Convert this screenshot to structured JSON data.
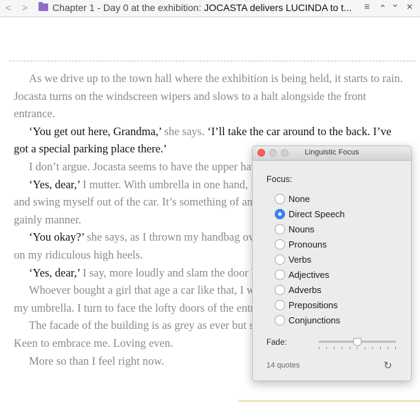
{
  "header": {
    "back_glyph": "<",
    "forward_glyph": ">",
    "title_prefix": "Chapter 1 - Day 0 at the exhibition: ",
    "title_bold": "JOCASTA delivers LUCINDA to t...",
    "menu_glyph": "≡",
    "up_glyph": "⌃",
    "down_glyph": "⌄",
    "close_glyph": "✕"
  },
  "editor": {
    "paragraphs": [
      [
        {
          "t": "As we drive up to the town hall where the exhibition is being held, it starts to rain. Jocasta turns on the windscreen wipers and slows to a halt alongside the front entrance.",
          "s": false
        }
      ],
      [
        {
          "t": "‘You get out here, Grandma,’",
          "s": true
        },
        {
          "t": " she says. ",
          "s": false
        },
        {
          "t": "‘I’ll take the car around to the back. I’ve got a special parking place there.’",
          "s": true
        }
      ],
      [
        {
          "t": "I don’t argue. Jocasta seems to have the upper hand today.",
          "s": false
        }
      ],
      [
        {
          "t": "‘Yes, dear,’",
          "s": true
        },
        {
          "t": " I mutter. With umbrella in one hand, I open the car door as best I can and swing myself out of the car. It’s something of an effort, but I make an exit in a gainly manner.",
          "s": false
        }
      ],
      [
        {
          "t": "‘You okay?’",
          "s": true
        },
        {
          "t": " she says, as I thrown my handbag over my shoulder and wobble a bit on my ridiculous high heels.",
          "s": false
        }
      ],
      [
        {
          "t": "‘Yes, dear,’",
          "s": true
        },
        {
          "t": " I say, more loudly and slam the door before teetering up the steps.",
          "s": false
        }
      ],
      [
        {
          "t": "Whoever bought a girl that age a car like that, I wonder. Not me, I think, as I open my umbrella. I turn to face the lofty doors of the entrance.",
          "s": false
        }
      ],
      [
        {
          "t": "The facade of the building is as grey as ever but somehow it seems welcoming. Keen to embrace me. Loving even.",
          "s": false
        }
      ],
      [
        {
          "t": "More so than I feel right now.",
          "s": false
        }
      ]
    ]
  },
  "panel": {
    "title": "Linguistic Focus",
    "focus_label": "Focus:",
    "options": [
      "None",
      "Direct Speech",
      "Nouns",
      "Pronouns",
      "Verbs",
      "Adjectives",
      "Adverbs",
      "Prepositions",
      "Conjunctions"
    ],
    "selected_index": 1,
    "fade_label": "Fade:",
    "fade_value": 0.5,
    "quotes_count": "14 quotes",
    "refresh_glyph": "↻"
  }
}
